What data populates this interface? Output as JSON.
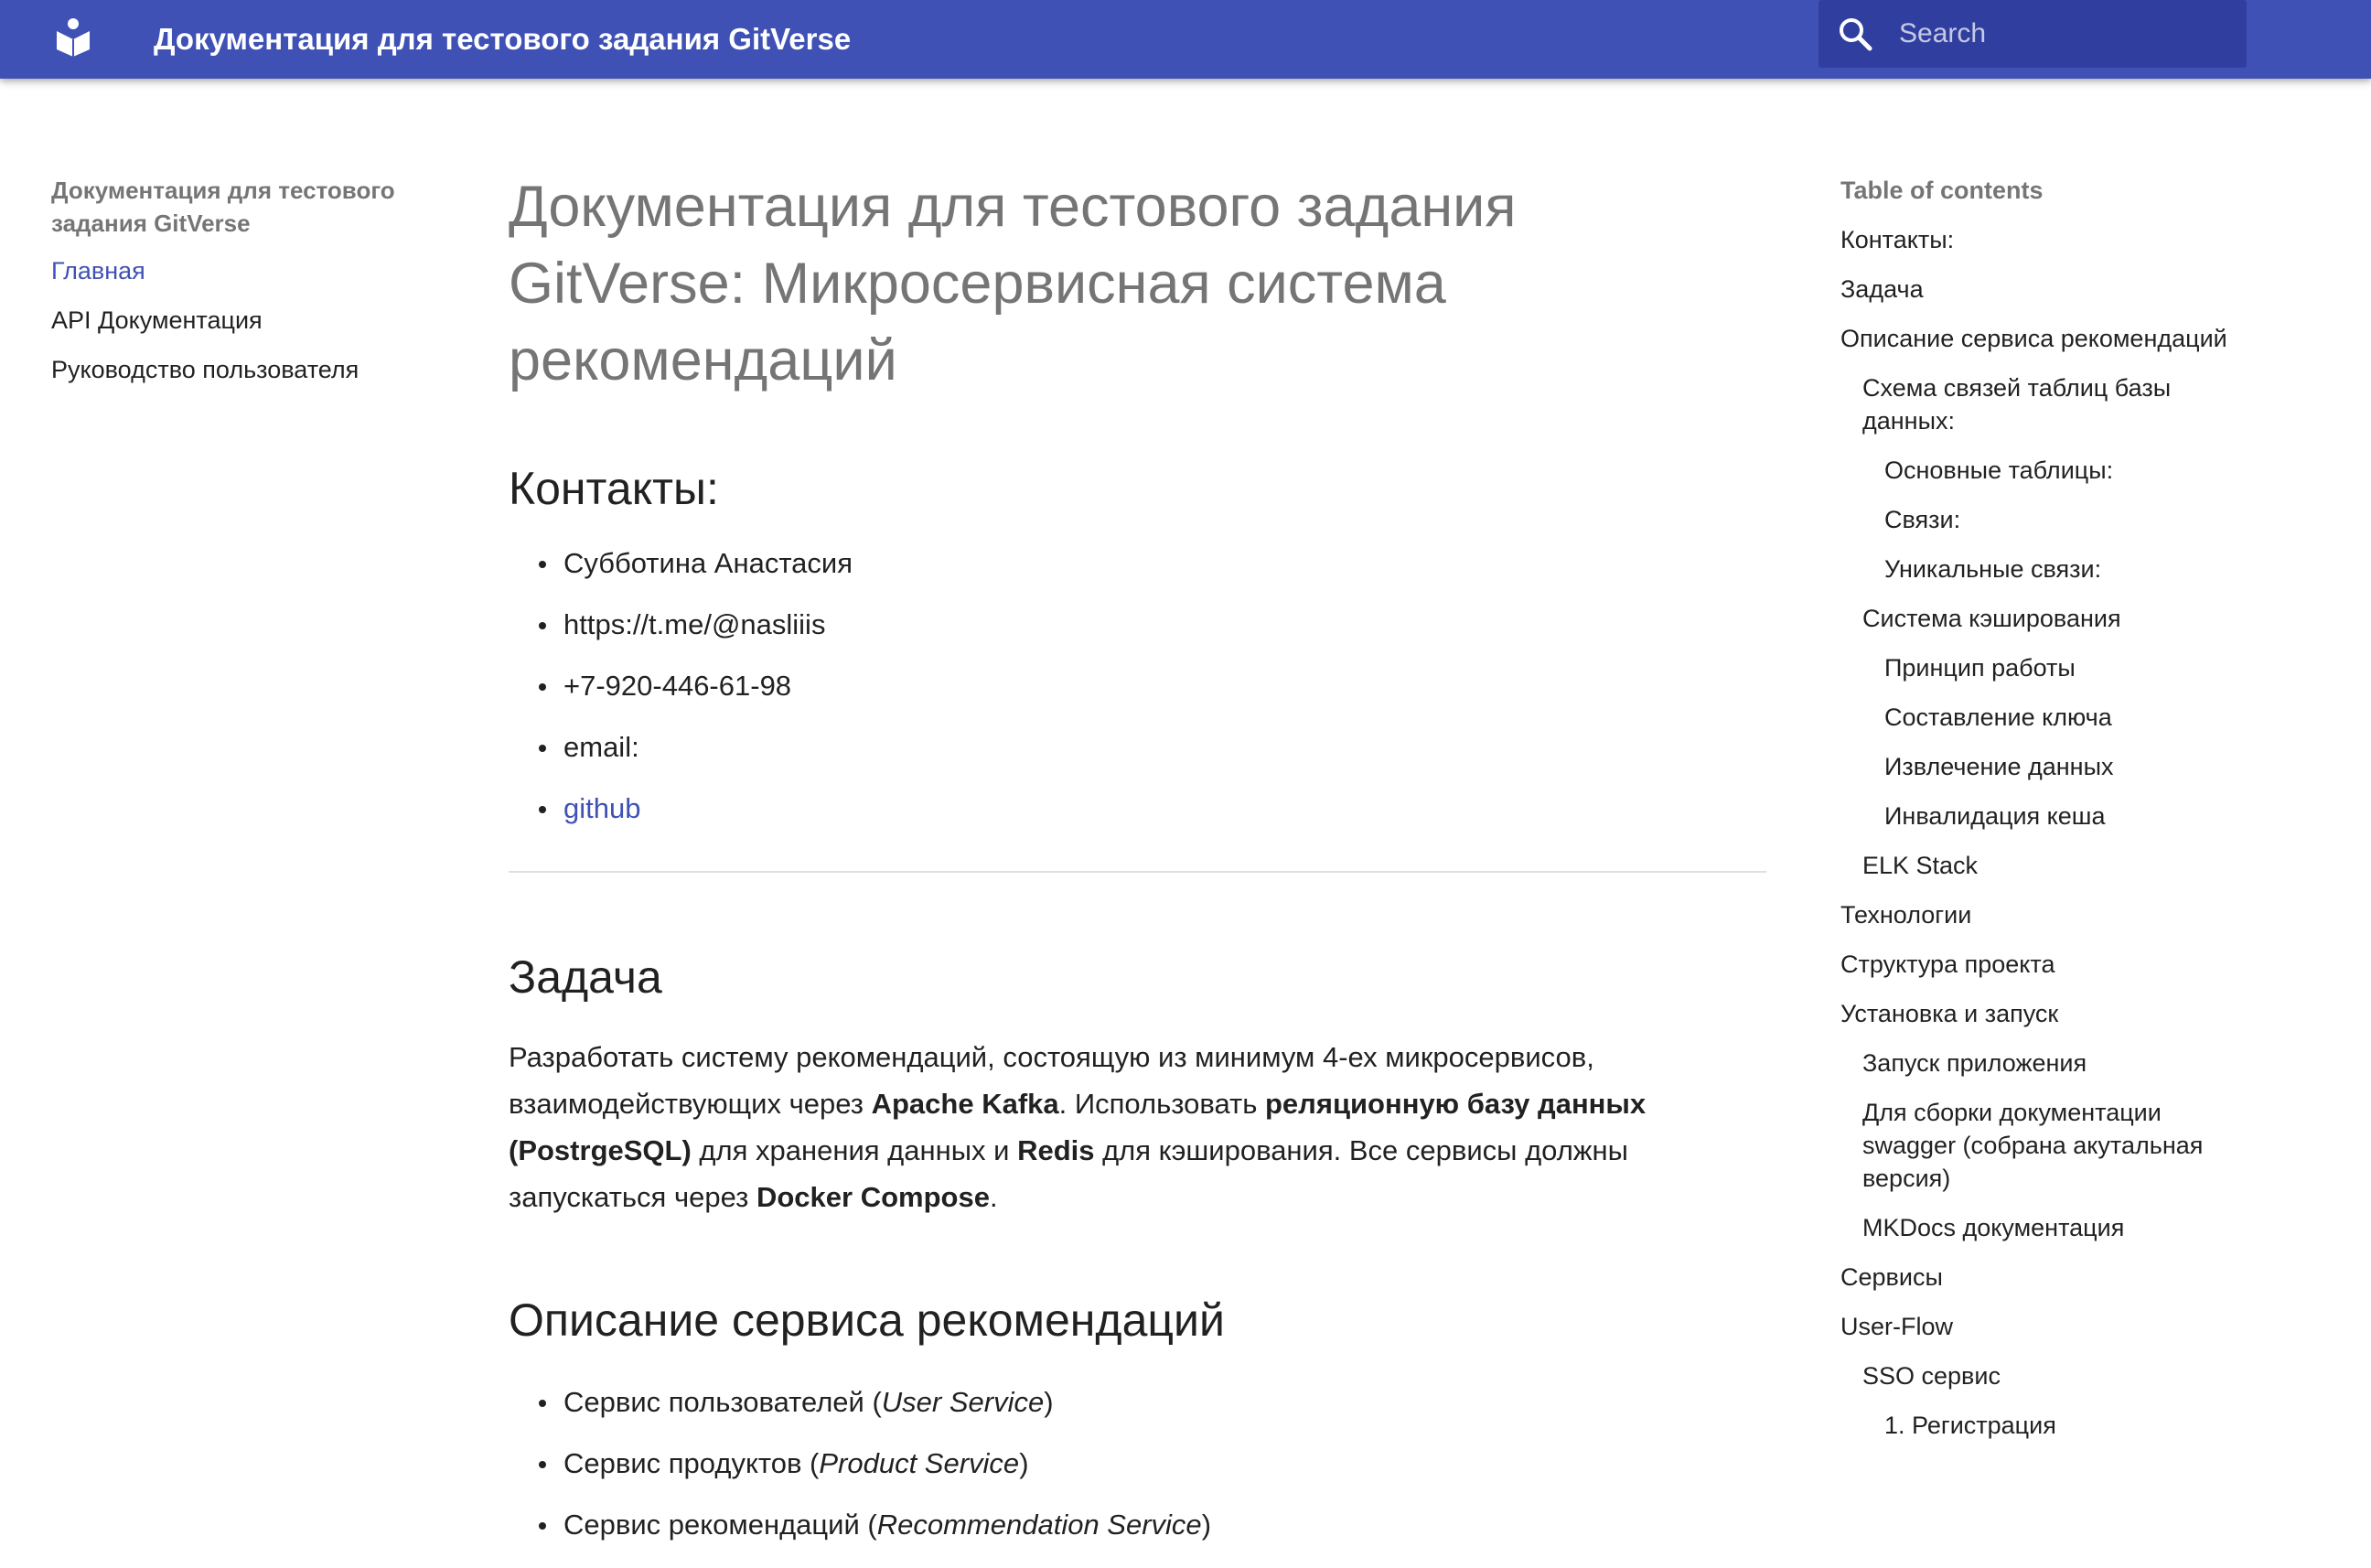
{
  "header": {
    "site_title": "Документация для тестового задания GitVerse",
    "logo_icon": "book-open-icon",
    "search_icon": "search-icon",
    "search_placeholder": "Search",
    "accent_color": "#3f51b5"
  },
  "sidebar": {
    "title": "Документация для тестового задания GitVerse",
    "items": [
      "Главная",
      "API Документация",
      "Руководство пользователя"
    ],
    "active_item": "Главная"
  },
  "main": {
    "title": "Документация для тестового задания GitVerse: Микросервисная система рекомендаций",
    "contacts": {
      "heading": "Контакты:",
      "items": [
        "Субботина Анастасия",
        "https://t.me/@nasliiis",
        "+7-920-446-61-98",
        "email:",
        "github"
      ]
    },
    "task": {
      "heading": "Задача",
      "p1": "Разработать систему рекомендаций, состоящую из минимум 4-ех микросервисов, взаимодействующих через ",
      "b1": "Apache Kafka",
      "p2": ". Использовать ",
      "b2": "реляционную базу данных (PostrgeSQL)",
      "p3": " для хранения данных и ",
      "b3": "Redis",
      "p4": " для кэширования. Все сервисы должны запускаться через ",
      "b4": "Docker Compose",
      "p5": "."
    },
    "services": {
      "heading": "Описание сервиса рекомендаций",
      "items": [
        {
          "text": "Сервис пользователей (",
          "em": "User Service",
          "end": ")"
        },
        {
          "text": "Сервис продуктов (",
          "em": "Product Service",
          "end": ")"
        },
        {
          "text": "Сервис рекомендаций (",
          "em": "Recommendation Service",
          "end": ")"
        }
      ]
    }
  },
  "toc": {
    "title": "Table of contents",
    "items": [
      "Контакты:",
      "Задача",
      "Описание сервиса рекомендаций",
      "Схема связей таблиц базы данных:",
      "Основные таблицы:",
      "Связи:",
      "Уникальные связи:",
      "Система кэширования",
      "Принцип работы",
      "Составление ключа",
      "Извлечение данных",
      "Инвалидация кеша",
      "ELK Stack",
      "Технологии",
      "Структура проекта",
      "Установка и запуск",
      "Запуск приложения",
      "Для сборки документации swagger (собрана акутальная версия)",
      "MKDocs документация",
      "Сервисы",
      "User-Flow",
      "SSO сервис",
      "1. Регистрация"
    ]
  }
}
